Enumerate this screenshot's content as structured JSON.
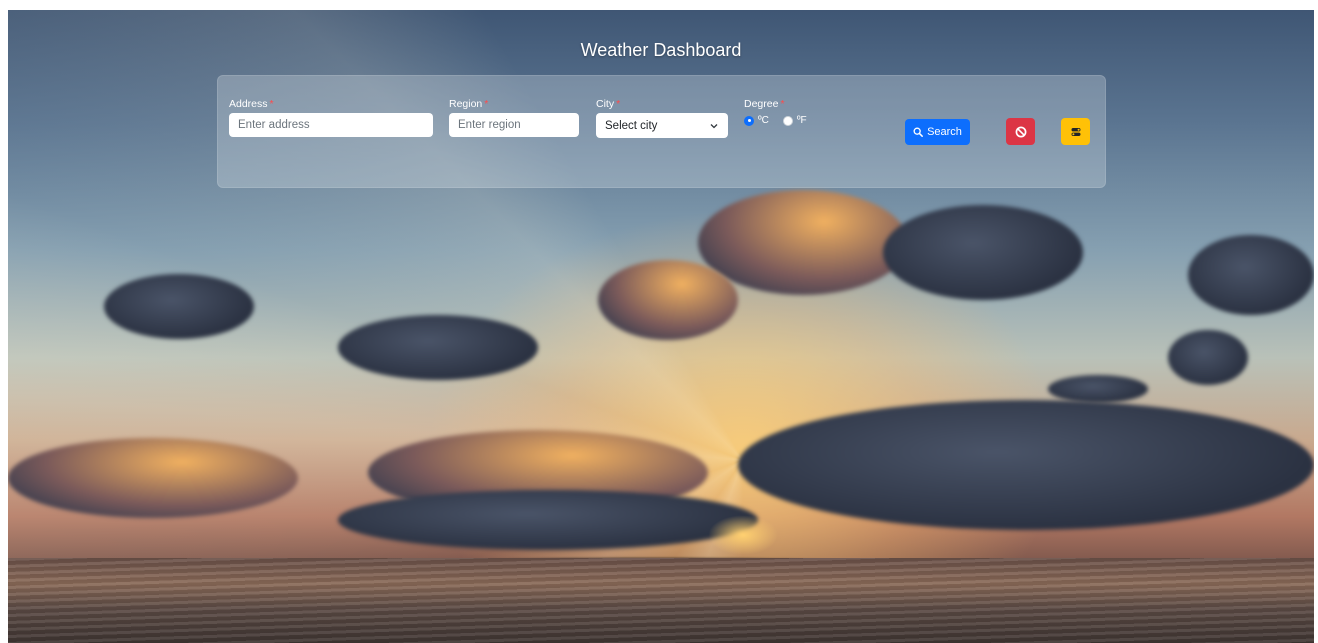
{
  "app": {
    "title": "Weather Dashboard"
  },
  "form": {
    "address": {
      "label": "Address",
      "required_mark": "*",
      "placeholder": "Enter address",
      "value": ""
    },
    "region": {
      "label": "Region",
      "required_mark": "*",
      "placeholder": "Enter region",
      "value": ""
    },
    "city": {
      "label": "City",
      "required_mark": "*",
      "selected": "Select city"
    },
    "degree": {
      "label": "Degree",
      "required_mark": "*",
      "options": [
        {
          "label": "ºC",
          "checked": true
        },
        {
          "label": "ºF",
          "checked": false
        }
      ]
    }
  },
  "buttons": {
    "search_label": "Search",
    "search_icon": "search-icon",
    "cancel_icon": "ban-icon",
    "extra_icon": "toggle-icon"
  },
  "colors": {
    "primary": "#0d6efd",
    "danger": "#dc3545",
    "warning": "#ffc107",
    "required": "#ff4b4b"
  }
}
